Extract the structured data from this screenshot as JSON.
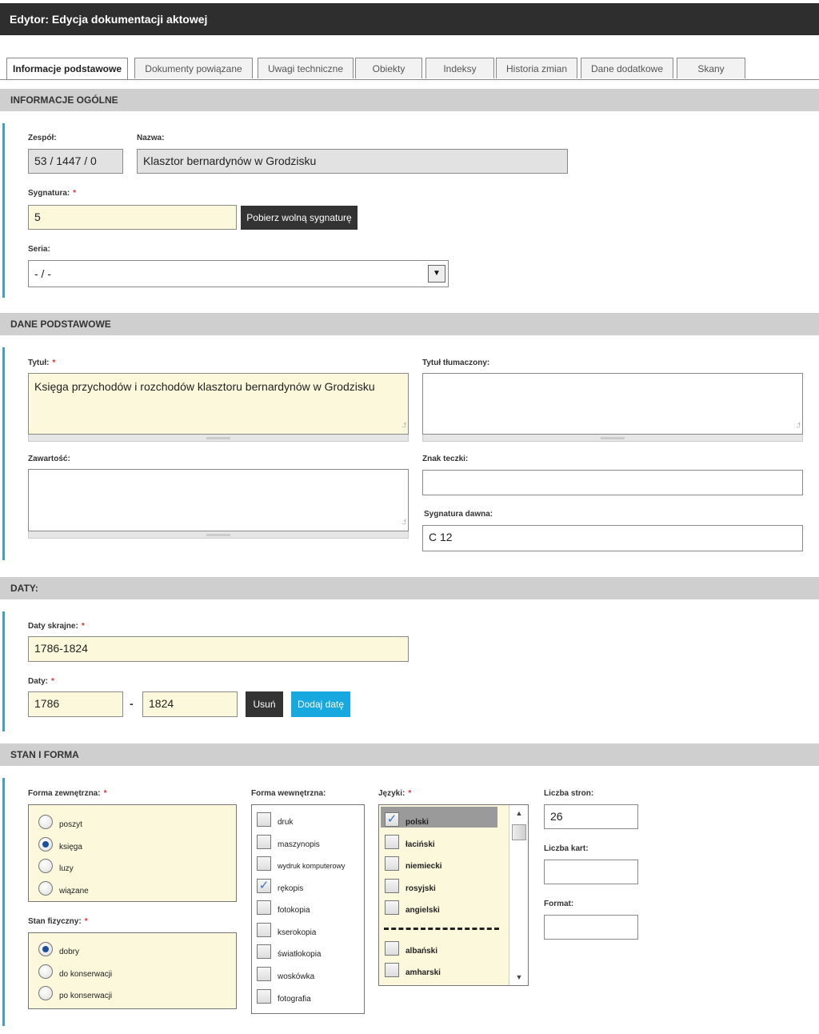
{
  "window": {
    "title": "Edytor: Edycja dokumentacji aktowej"
  },
  "tabs": [
    {
      "label": "Informacje podstawowe",
      "active": true
    },
    {
      "label": "Dokumenty powiązane"
    },
    {
      "label": "Uwagi techniczne"
    },
    {
      "label": "Obiekty"
    },
    {
      "label": "Indeksy"
    },
    {
      "label": "Historia zmian"
    },
    {
      "label": "Dane dodatkowe"
    },
    {
      "label": "Skany"
    }
  ],
  "sections": {
    "informacje": "INFORMACJE OGÓLNE",
    "dane": "DANE PODSTAWOWE",
    "daty": "DATY:",
    "stan": "STAN I FORMA"
  },
  "informacje": {
    "zespol_label": "Zespół:",
    "zespol_value": "53 / 1447 / 0",
    "nazwa_label": "Nazwa:",
    "nazwa_value": "Klasztor bernardynów w Grodzisku",
    "sygnatura_label": "Sygnatura:",
    "sygnatura_value": "5",
    "pobierz_button": "Pobierz wolną sygnaturę",
    "seria_label": "Seria:",
    "seria_value": "- / -",
    "required_mark": "*",
    "select_arrow": "▼"
  },
  "dane": {
    "tytul_label": "Tytuł:",
    "tytul_value": "Księga przychodów i rozchodów klasztoru bernardynów w Grodzisku",
    "tytul_tlum_label": "Tytuł tłumaczony:",
    "tytul_tlum_value": "",
    "zawartosc_label": "Zawartość:",
    "zawartosc_value": "",
    "znak_label": "Znak teczki:",
    "znak_value": "",
    "sygn_dawna_label": "Sygnatura dawna:",
    "sygn_dawna_value": "C 12",
    "resize_glyph": ".:!"
  },
  "daty": {
    "skrajne_label": "Daty skrajne:",
    "skrajne_value": "1786-1824",
    "daty_label": "Daty:",
    "od_value": "1786",
    "separator": "-",
    "do_value": "1824",
    "usun_button": "Usuń",
    "dodaj_button": "Dodaj datę"
  },
  "stan": {
    "forma_zewn_label": "Forma zewnętrzna:",
    "forma_zewn_options": [
      {
        "label": "poszyt",
        "selected": false
      },
      {
        "label": "księga",
        "selected": true
      },
      {
        "label": "luzy",
        "selected": false
      },
      {
        "label": "wiązane",
        "selected": false
      }
    ],
    "stan_fiz_label": "Stan fizyczny:",
    "stan_fiz_options": [
      {
        "label": "dobry",
        "selected": true
      },
      {
        "label": "do konserwacji",
        "selected": false
      },
      {
        "label": "po konserwacji",
        "selected": false
      }
    ],
    "forma_wewn_label": "Forma wewnętrzna:",
    "forma_wewn_options": [
      {
        "label": "druk",
        "checked": false
      },
      {
        "label": "maszynopis",
        "checked": false
      },
      {
        "label": "wydruk komputerowy",
        "checked": false
      },
      {
        "label": "rękopis",
        "checked": true
      },
      {
        "label": "fotokopia",
        "checked": false
      },
      {
        "label": "kserokopia",
        "checked": false
      },
      {
        "label": "światłokopia",
        "checked": false
      },
      {
        "label": "woskówka",
        "checked": false
      },
      {
        "label": "fotografia",
        "checked": false
      }
    ],
    "jezyki_label": "Języki:",
    "jezyki_options": [
      {
        "label": "polski",
        "checked": true
      },
      {
        "label": "łaciński",
        "checked": false
      },
      {
        "label": "niemiecki",
        "checked": false
      },
      {
        "label": "rosyjski",
        "checked": false
      },
      {
        "label": "angielski",
        "checked": false
      },
      {
        "label": "albański",
        "checked": false
      },
      {
        "label": "amharski",
        "checked": false
      }
    ],
    "check_glyph": "✓",
    "scroll_up": "▲",
    "scroll_down": "▼",
    "liczba_stron_label": "Liczba stron:",
    "liczba_stron_value": "26",
    "liczba_kart_label": "Liczba kart:",
    "liczba_kart_value": "",
    "format_label": "Format:",
    "format_value": ""
  }
}
